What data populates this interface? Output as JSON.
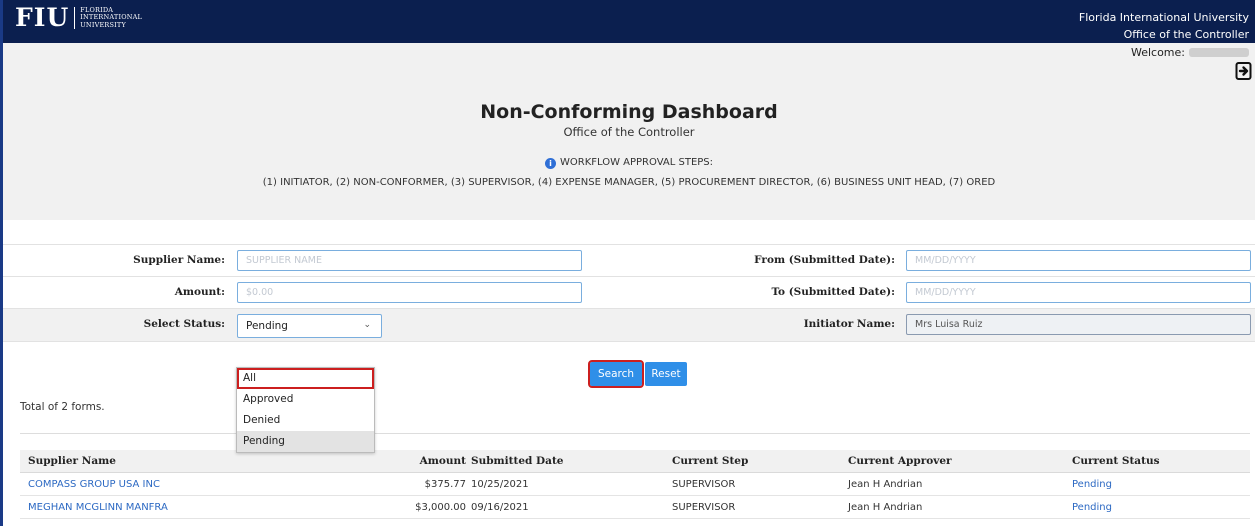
{
  "header": {
    "logo_mark": "FIU",
    "logo_words": [
      "FLORIDA",
      "INTERNATIONAL",
      "UNIVERSITY"
    ],
    "org_name": "Florida International University",
    "office_name": "Office of the Controller",
    "welcome_label": "Welcome:"
  },
  "page": {
    "title": "Non-Conforming Dashboard",
    "subtitle": "Office of the Controller",
    "workflow_heading": "WORKFLOW APPROVAL STEPS:",
    "workflow_steps": "(1) INITIATOR, (2) NON-CONFORMER, (3) SUPERVISOR, (4) EXPENSE MANAGER, (5) PROCUREMENT DIRECTOR, (6) BUSINESS UNIT HEAD, (7) ORED"
  },
  "form": {
    "supplier_label": "Supplier Name:",
    "supplier_placeholder": "SUPPLIER NAME",
    "from_label": "From (Submitted Date):",
    "from_placeholder": "MM/DD/YYYY",
    "amount_label": "Amount:",
    "amount_placeholder": "$0.00",
    "to_label": "To (Submitted Date):",
    "to_placeholder": "MM/DD/YYYY",
    "status_label": "Select Status:",
    "status_value": "Pending",
    "status_options": [
      "All",
      "Approved",
      "Denied",
      "Pending"
    ],
    "initiator_label": "Initiator Name:",
    "initiator_value": "Mrs Luisa Ruiz",
    "search_label": "Search",
    "reset_label": "Reset"
  },
  "results": {
    "total_text": "Total of 2 forms.",
    "columns": [
      "Supplier Name",
      "Amount",
      "Submitted Date",
      "Current Step",
      "Current Approver",
      "Current Status"
    ],
    "rows": [
      {
        "supplier": "COMPASS GROUP USA INC",
        "amount": "$375.77",
        "date": "10/25/2021",
        "step": "SUPERVISOR",
        "approver": "Jean H Andrian",
        "status": "Pending"
      },
      {
        "supplier": "MEGHAN MCGLINN MANFRA",
        "amount": "$3,000.00",
        "date": "09/16/2021",
        "step": "SUPERVISOR",
        "approver": "Jean H Andrian",
        "status": "Pending"
      }
    ]
  },
  "colors": {
    "top_bar": "#0b1f4f",
    "accent_button": "#2f8fe8",
    "link": "#2c69c3",
    "highlight_outline": "#cc1f1f"
  }
}
